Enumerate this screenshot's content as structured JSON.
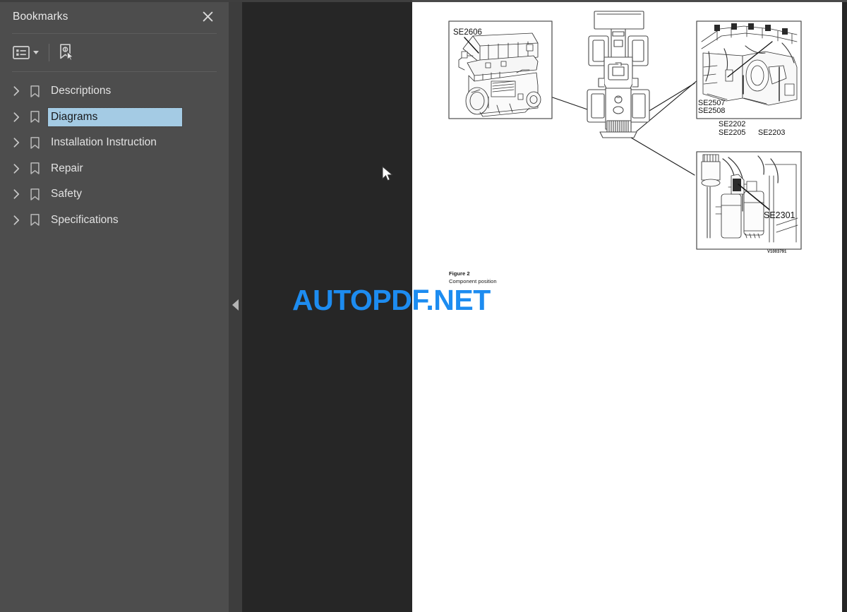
{
  "sidebar": {
    "title": "Bookmarks",
    "close_label": "Close",
    "close_icon": "close-icon",
    "toolbar": {
      "options_label": "Bookmark options",
      "options_icon": "list-options-icon",
      "caret_icon": "chevron-down-icon",
      "new_bookmark_label": "New bookmark",
      "new_bookmark_icon": "new-bookmark-icon"
    },
    "items": [
      {
        "label": "Descriptions",
        "selected": false,
        "expanded": false
      },
      {
        "label": "Diagrams",
        "selected": true,
        "expanded": false
      },
      {
        "label": "Installation Instruction",
        "selected": false,
        "expanded": false
      },
      {
        "label": "Repair",
        "selected": false,
        "expanded": false
      },
      {
        "label": "Safety",
        "selected": false,
        "expanded": false
      },
      {
        "label": "Specifications",
        "selected": false,
        "expanded": false
      }
    ],
    "twisty_icon": "chevron-right-icon",
    "bookmark_icon": "bookmark-icon",
    "colors": {
      "panel_bg": "#4d4d4d",
      "selection_bg": "#a4cbe4",
      "selection_text": "#17181a",
      "text": "#e2e2e2"
    }
  },
  "splitter": {
    "collapse_label": "Collapse panel",
    "collapse_icon": "triangle-left-icon"
  },
  "viewer": {
    "background_color": "#262626",
    "page_background": "#ffffff",
    "cursor_icon": "arrow-cursor"
  },
  "watermark": {
    "text": "AUTOPDF.NET",
    "color": "#1d8cf0"
  },
  "document": {
    "figure_number": "Figure 2",
    "figure_title": "Component position",
    "image_reference": "V1003791",
    "callouts": {
      "engine_left": [
        "SE2606"
      ],
      "engine_right": [
        "SE2507",
        "SE2508",
        "SE2202",
        "SE2205",
        "SE2203"
      ],
      "fuel_filter": [
        "SE2301"
      ]
    },
    "panels": [
      {
        "name": "engine-left-panel",
        "labels": [
          "SE2606"
        ]
      },
      {
        "name": "machine-top-view",
        "labels": []
      },
      {
        "name": "engine-right-panel",
        "labels": [
          "SE2507",
          "SE2508",
          "SE2202",
          "SE2205",
          "SE2203"
        ]
      },
      {
        "name": "fuel-filter-panel",
        "labels": [
          "SE2301"
        ]
      }
    ]
  }
}
